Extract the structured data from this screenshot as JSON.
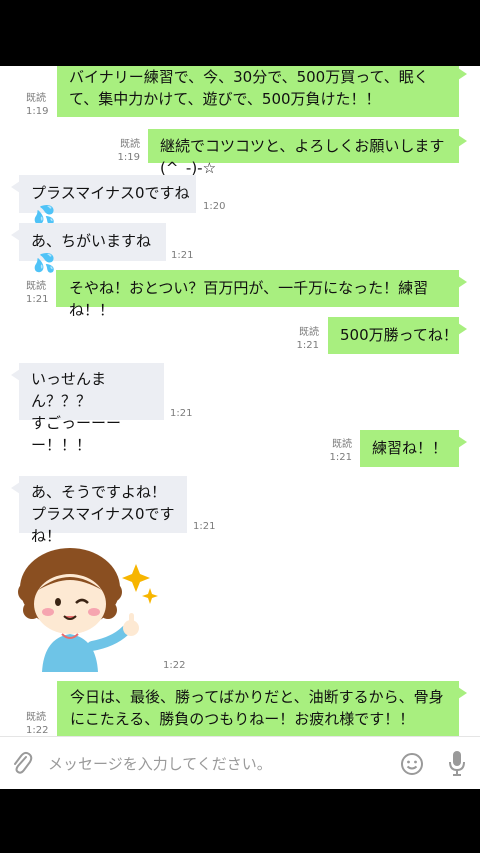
{
  "read_label": "既読",
  "messages": [
    {
      "text": "バイナリー練習で、今、30分で、500万買って、眠くて、集中力かけて、遊びで、500万負けた！！",
      "time": "1:19"
    },
    {
      "text": "継続でコツコツと、よろしくお願いします(^_-)-☆",
      "time": "1:19"
    },
    {
      "text": "プラスマイナス0ですね",
      "time": "1:20"
    },
    {
      "text": "あ、ちがいますね",
      "time": "1:21"
    },
    {
      "text": "そやね！おとつい？百万円が、一千万になった！練習ね！！",
      "time": "1:21"
    },
    {
      "text": "500万勝ってね！",
      "time": "1:21"
    },
    {
      "text_line1": "いっせんまん？？？",
      "text_line2": "すごっーーーー！！！",
      "time": "1:21"
    },
    {
      "text": "練習ね！！",
      "time": "1:21"
    },
    {
      "text_line1": "あ、そうですよね！",
      "text_line2": "プラスマイナス0ですね！",
      "time": "1:21"
    },
    {
      "sticker": "girl-thumbs-up-sticker",
      "time": "1:22"
    },
    {
      "text": "今日は、最後、勝ってばかりだと、油断するから、骨身にこたえる、勝負のつもりねー！お疲れ様です！！",
      "time": "1:22"
    }
  ],
  "input": {
    "placeholder": "メッセージを入力してください。"
  },
  "icons": {
    "attach": "paperclip-icon",
    "emoji": "smiley-icon",
    "mic": "microphone-icon",
    "sweat": "sweat-drops-icon"
  }
}
